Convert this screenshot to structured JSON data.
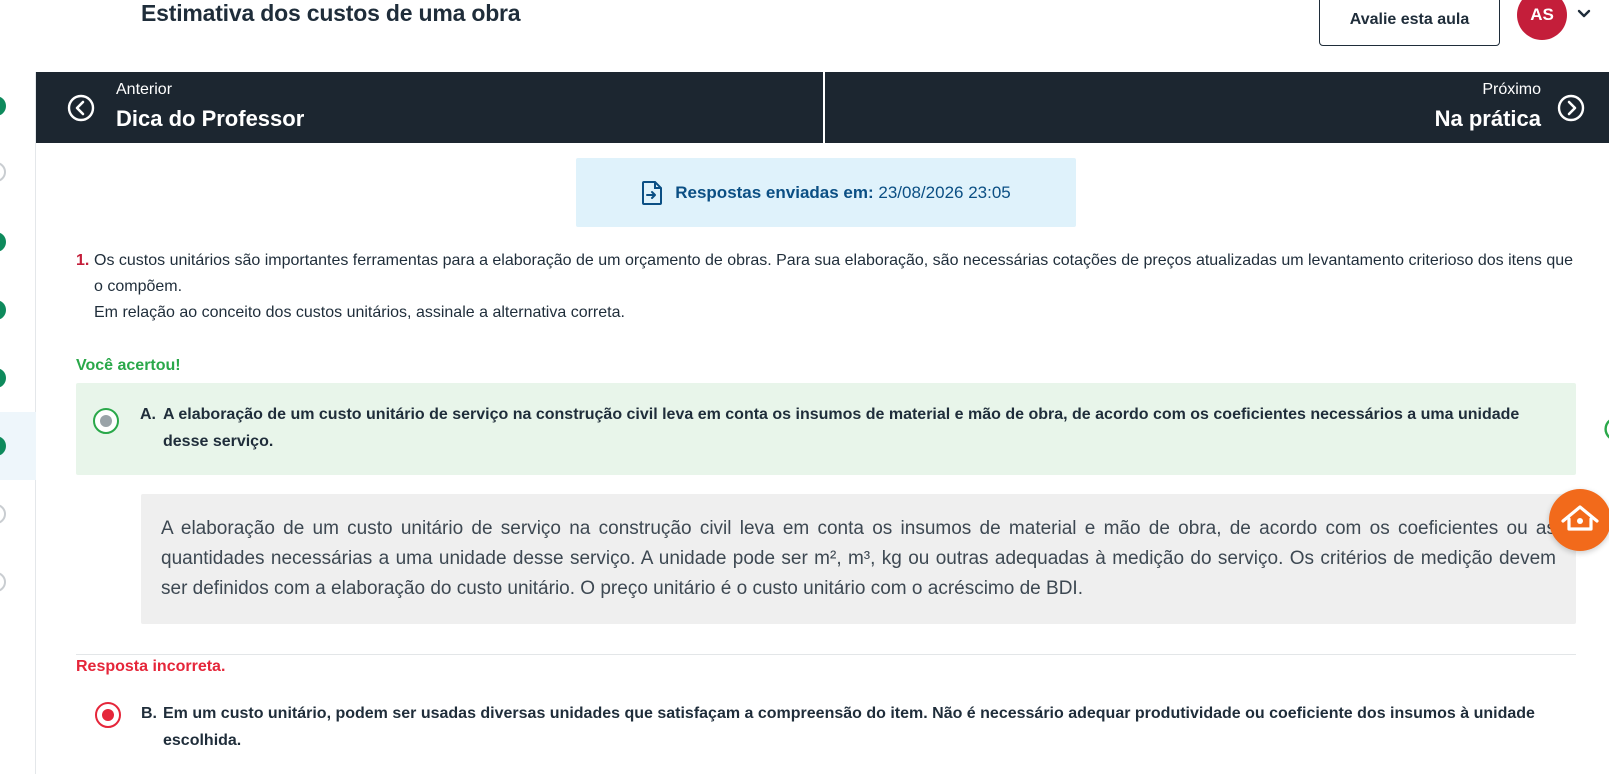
{
  "header": {
    "title": "Estimativa dos custos de uma obra",
    "rate_button": "Avalie esta aula",
    "avatar_initials": "AS"
  },
  "nav": {
    "prev_small": "Anterior",
    "prev_title": "Dica do Professor",
    "next_small": "Próximo",
    "next_title": "Na prática"
  },
  "submission": {
    "label": "Respostas enviadas em:",
    "datetime": "23/08/2026 23:05"
  },
  "question": {
    "number": "1.",
    "line1": "Os custos unitários são importantes ferramentas para a elaboração de um orçamento de obras. Para sua elaboração, são necessárias cotações de preços atualizadas um levantamento criterioso dos itens que o compõem.",
    "line2": "Em relação ao conceito dos custos unitários, assinale a alternativa correta."
  },
  "options": [
    {
      "feedback": "Você acertou!",
      "letter": "A.",
      "text": "A elaboração de um custo unitário de serviço na construção civil leva em conta os insumos de material e mão de obra, de acordo com os coeficientes necessários a uma unidade desse serviço.",
      "explanation": "A elaboração de um custo unitário de serviço na construção civil leva em conta os insumos de material e mão de obra, de acordo com os coeficientes ou as quantidades necessárias a uma unidade desse serviço. A unidade pode ser m², m³, kg ou outras adequadas à medição do serviço. Os critérios de medição devem ser definidos com a elaboração do custo unitário. O preço unitário é o custo unitário com o acréscimo de BDI."
    },
    {
      "feedback": "Resposta incorreta.",
      "letter": "B.",
      "text": "Em um custo unitário, podem ser usadas diversas unidades que satisfaçam a compreensão do item. Não é necessário adequar produtividade ou coeficiente dos insumos à unidade escolhida."
    }
  ],
  "colors": {
    "nav_bg": "#1c2630",
    "accent_red": "#c41e3a",
    "correct_green": "#2aa84a",
    "wrong_red": "#e5263a",
    "fab_orange": "#f26a1b"
  }
}
